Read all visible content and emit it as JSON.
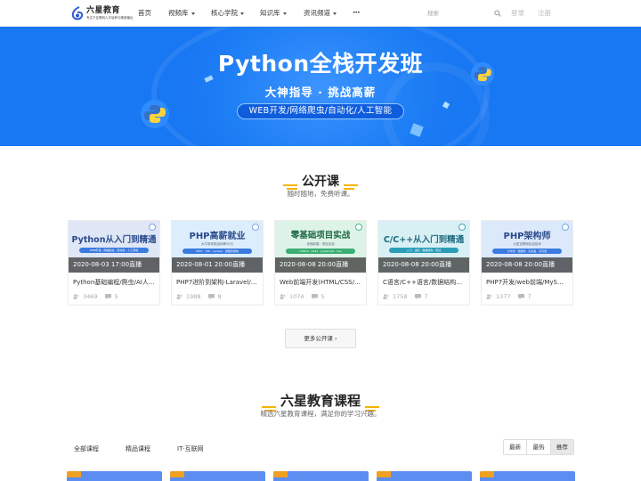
{
  "nav": {
    "logo_title": "六星教育",
    "logo_subtitle": "专注于互联网人才培养与精英输出",
    "items": [
      {
        "label": "首页",
        "has_caret": false
      },
      {
        "label": "视频库",
        "has_caret": true
      },
      {
        "label": "核心学院",
        "has_caret": true
      },
      {
        "label": "知识库",
        "has_caret": true
      },
      {
        "label": "资讯频道",
        "has_caret": true
      },
      {
        "label": "•••",
        "has_caret": false
      }
    ],
    "search_placeholder": "搜索",
    "login": "登录",
    "register": "注册"
  },
  "banner": {
    "title": "Python全栈开发班",
    "subtitle": "大神指导 · 挑战高薪",
    "pill": "WEB开发/网络爬虫/自动化/人工智能"
  },
  "open_courses": {
    "title": "公开课",
    "subtitle": "随时随地，免费听课。",
    "more_label": "更多公开课 ›",
    "cards": [
      {
        "img_title": "Python从入门到精通",
        "img_tag": "WEB开发 · 网络爬虫 · 自动化 · 人工智能",
        "date": "2020-08-03 17:00直播",
        "name": "Python基础编程/爬虫/AI人...",
        "learners": "3469",
        "comments": "5"
      },
      {
        "img_title": "PHP高薪就业",
        "img_sub": "大牛带你挑战年薪30万",
        "img_tag": "PHP7 · TP6 · Laravel · 微服务架构",
        "date": "2020-08-01 20:00直播",
        "name": "PHP7进阶到架构-Laravel/R...",
        "learners": "1988",
        "comments": "8"
      },
      {
        "img_title": "零基础项目实战",
        "img_sub": "全栈前端 · 项目实战",
        "img_tag": "HTML5 · CSS3 · JavaScript · Vue",
        "date": "2020-08-08 20:00直播",
        "name": "Web前端开发(HTML/CSS/j...",
        "learners": "1074",
        "comments": "5"
      },
      {
        "img_title": "C/C++从入门到精通",
        "img_tag": "入门 · 进阶 · 数据结构 · 算法",
        "date": "2020-08-08 20:00直播",
        "name": "C语言/C++语言/数据结构算...",
        "learners": "1758",
        "comments": "7"
      },
      {
        "img_title": "PHP架构师",
        "img_sub": "大型互联网实战技术",
        "img_tag": "分布式 · 微服务 · 高并发 · 高可用",
        "date": "2020-08-08 20:00直播",
        "name": "PHP7开发/web前端/MySQ...",
        "learners": "1377",
        "comments": "7"
      }
    ]
  },
  "courses": {
    "title": "六星教育课程",
    "subtitle": "精选六星教育课程，满足你的学习兴趣。",
    "tabs": [
      "全部课程",
      "精品课程",
      "IT·互联网"
    ],
    "sort": [
      "最新",
      "最热",
      "推荐"
    ]
  },
  "colors": {
    "banner_blue": "#1877f2",
    "accent_orange": "#f0a020"
  }
}
